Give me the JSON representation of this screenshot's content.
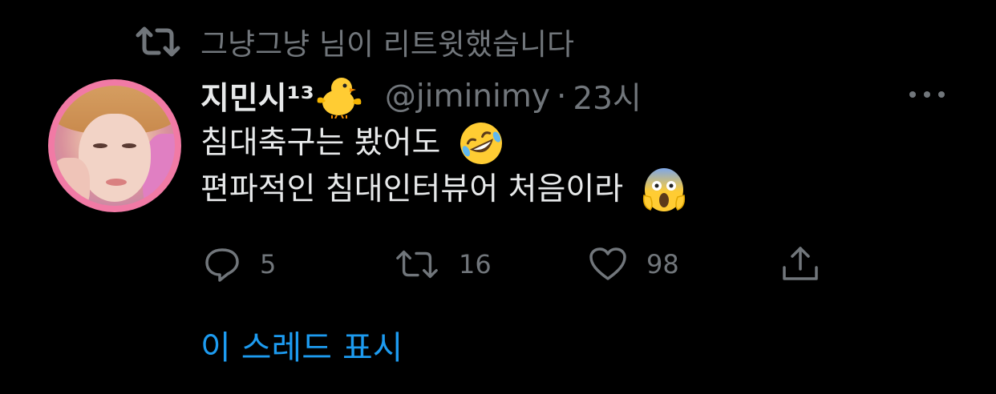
{
  "retweet": {
    "icon": "retweet-icon",
    "text": "그냥그냥 님이 리트윗했습니다"
  },
  "tweet": {
    "display_name": "지민시¹³",
    "name_emoji": "baby-chick-emoji",
    "handle": "@jiminimy",
    "separator": "·",
    "time": "23시",
    "text_lines": [
      "침대축구는 봤어도",
      "편파적인 침대인터뷰어 처음이라"
    ],
    "line_emojis": [
      "rolling-on-floor-laughing-emoji",
      "face-screaming-in-fear-emoji"
    ]
  },
  "actions": {
    "reply_count": "5",
    "retweet_count": "16",
    "like_count": "98"
  },
  "thread_link": "이 스레드 표시",
  "colors": {
    "background": "#000000",
    "text": "#e7e9ea",
    "secondary": "#71767b",
    "link": "#1d9bf0",
    "avatar_ring": "#f17aa5"
  }
}
